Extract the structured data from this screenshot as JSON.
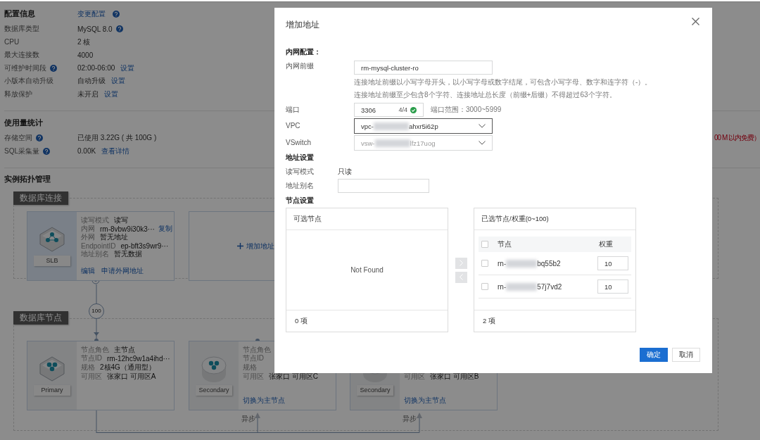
{
  "config": {
    "title": "配置信息",
    "action": "变更配置",
    "rows": [
      {
        "label": "数据库类型",
        "value": "MySQL  8.0",
        "value_help": true
      },
      {
        "label": "CPU",
        "value": "2 核"
      },
      {
        "label": "最大连接数",
        "value": "4000"
      },
      {
        "label": "可维护时间段",
        "value": "02:00-06:00",
        "label_help": true,
        "link": "设置"
      },
      {
        "label": "小版本自动升级",
        "value": "自动升级",
        "link": "设置"
      },
      {
        "label": "释放保护",
        "value": "未开启",
        "link": "设置"
      }
    ]
  },
  "usage": {
    "title": "使用量统计",
    "rows": [
      {
        "label": "存储空间",
        "value": "已使用 3.22G ( 共 100G )",
        "label_help": true,
        "note": "00 M 以内免费）"
      },
      {
        "label": "SQL采集量",
        "value": "0.00K",
        "label_help": true,
        "link": "查看详情"
      }
    ]
  },
  "topology": {
    "title": "实例拓扑管理",
    "connection": {
      "title": "数据库连接",
      "slb": {
        "icon_label": "SLB",
        "rows": [
          {
            "label": "读写模式",
            "value": "读写"
          },
          {
            "label": "内网",
            "value": "rm-8vbw9i30k3···",
            "link": "复制"
          },
          {
            "label": "外网",
            "value": "暂无地址"
          },
          {
            "label": "EndpointID",
            "value": "ep-bft3s9wr9···"
          },
          {
            "label": "地址别名",
            "value": "暂无数据"
          }
        ],
        "links": [
          "编辑",
          "申请外网地址"
        ]
      },
      "add_button": "增加地址",
      "weight": "100"
    },
    "nodes": {
      "title": "数据库节点",
      "items": [
        {
          "kind": "primary",
          "icon_label": "Primary",
          "rows": [
            {
              "label": "节点角色",
              "value": "主节点"
            },
            {
              "label": "节点ID",
              "value": "rm-12hc9w1a4ihd···"
            },
            {
              "label": "规格",
              "value": "2核4G（通用型）"
            },
            {
              "label": "可用区",
              "value": "张家口 可用区A"
            }
          ]
        },
        {
          "kind": "secondary",
          "icon_label": "Secondary",
          "rows": [
            {
              "label": "节点角色"
            },
            {
              "label": "节点ID"
            },
            {
              "label": "规格"
            },
            {
              "label": "可用区",
              "value": "张家口 可用区C"
            }
          ],
          "link": "切换为主节点",
          "sync": "异步"
        },
        {
          "kind": "secondary",
          "icon_label": "Secondary",
          "rows": [
            {
              "label": "可用区",
              "value": "张家口 可用区B"
            }
          ],
          "link": "切换为主节点",
          "sync": "异步"
        }
      ]
    }
  },
  "modal": {
    "title": "增加地址",
    "intranet": {
      "heading": "内网配置：",
      "prefix": {
        "label": "内网前缀",
        "value": "rm-mysql-cluster-ro",
        "hints": [
          "连接地址前缀以小写字母开头，以小写字母或数字结尾，可包含小写字母、数字和连字符（-）。",
          "连接地址前缀至少包含8个字符、连接地址总长度（前缀+后缀）不得超过63个字符。"
        ]
      },
      "port": {
        "label": "端口",
        "value": "3306",
        "counter": "4/4",
        "valid": true,
        "range": "端口范围：3000~5999"
      },
      "vpc": {
        "label": "VPC",
        "prefix": "vpc-",
        "suffix": "ahxr5i62p",
        "redacted": true,
        "focused": true
      },
      "vswitch": {
        "label": "VSwitch",
        "prefix": "vsw-",
        "suffix": "lfz17uog",
        "redacted": true,
        "focused": false
      }
    },
    "address": {
      "heading": "地址设置",
      "mode": {
        "label": "读写模式",
        "value": "只读"
      },
      "alias": {
        "label": "地址别名"
      }
    },
    "nodes": {
      "heading": "节点设置",
      "available": {
        "title": "可选节点",
        "empty": "Not Found",
        "count": "0 项"
      },
      "selected": {
        "title": "已选节点/权重(0~100)",
        "columns": [
          "节点",
          "权重"
        ],
        "all_checked": false,
        "rows": [
          {
            "prefix": "rn-",
            "suffix": "bq55b2",
            "redacted": true,
            "checked": false,
            "weight": "10"
          },
          {
            "prefix": "rn-",
            "suffix": "57j7vd2",
            "redacted": true,
            "checked": false,
            "weight": "10"
          }
        ],
        "count": "2 项"
      }
    },
    "buttons": [
      {
        "label": "确定",
        "kind": "primary"
      },
      {
        "label": "取消",
        "kind": "default"
      }
    ]
  }
}
